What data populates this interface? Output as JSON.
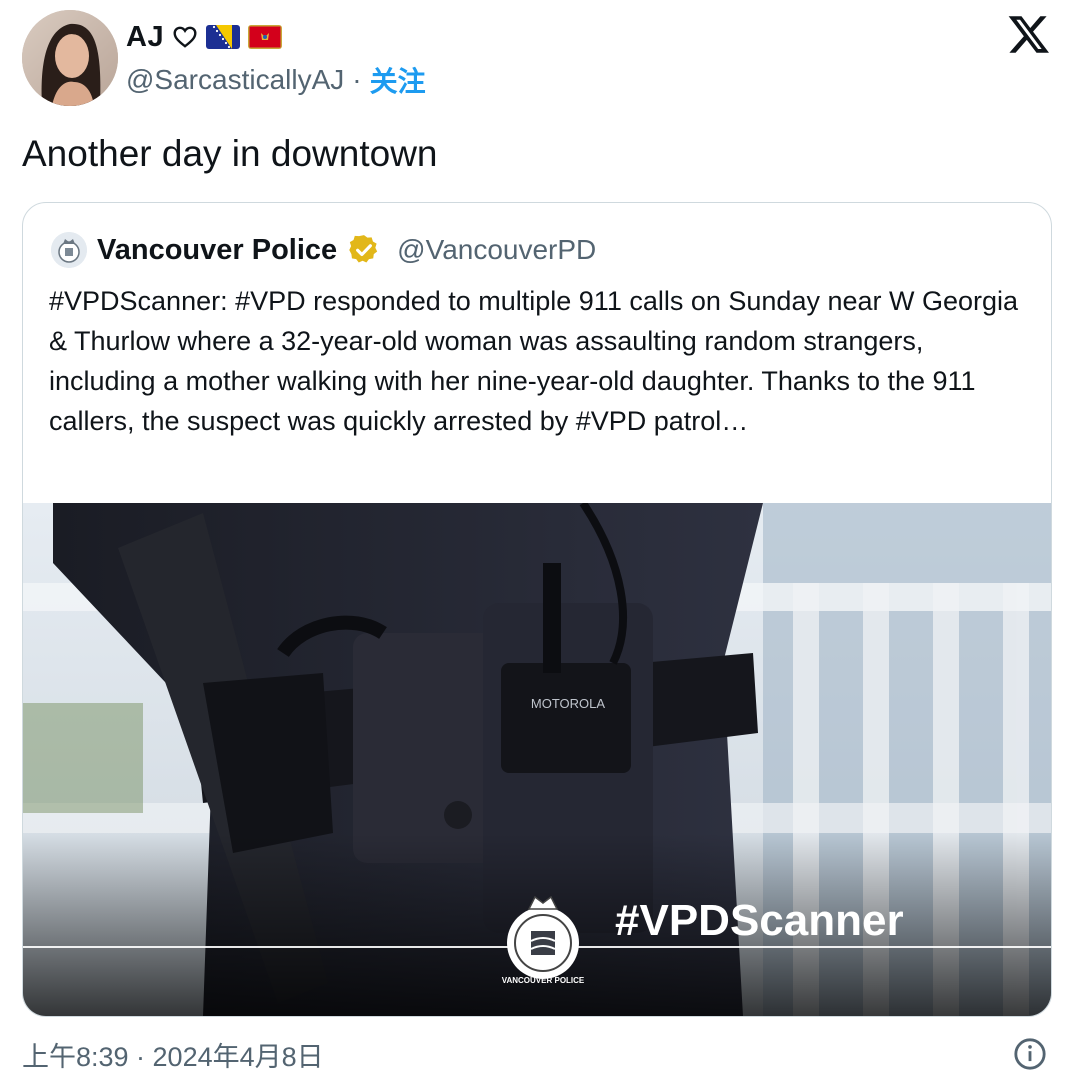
{
  "author": {
    "display_name": "AJ",
    "handle": "@SarcasticallyAJ",
    "separator": "·",
    "follow_label": "关注",
    "emoji": [
      "heart-outline",
      "bosnia-flag",
      "montenegro-flag"
    ]
  },
  "tweet": {
    "text": "Another day in downtown"
  },
  "quoted_tweet": {
    "display_name": "Vancouver Police",
    "handle": "@VancouverPD",
    "verified": "gold-check",
    "text": "#VPDScanner: #VPD responded to multiple 911 calls on Sunday near W Georgia & Thurlow where a 32-year-old woman was assaulting random strangers, including a mother walking with her nine-year-old daughter. Thanks to the 911 callers, the suspect was quickly arrested by #VPD patrol…",
    "media": {
      "overlay_text": "#VPDScanner",
      "radio_brand": "MOTOROLA",
      "badge_ring_text": "VANCOUVER POLICE"
    }
  },
  "footer": {
    "timestamp": "上午8:39 · 2024年4月8日",
    "info_icon": "info-icon"
  },
  "colors": {
    "text_primary": "#0f1419",
    "text_secondary": "#536471",
    "accent": "#1d9bf0",
    "border": "#cfd9de",
    "verified_gold": "#e2b719"
  }
}
